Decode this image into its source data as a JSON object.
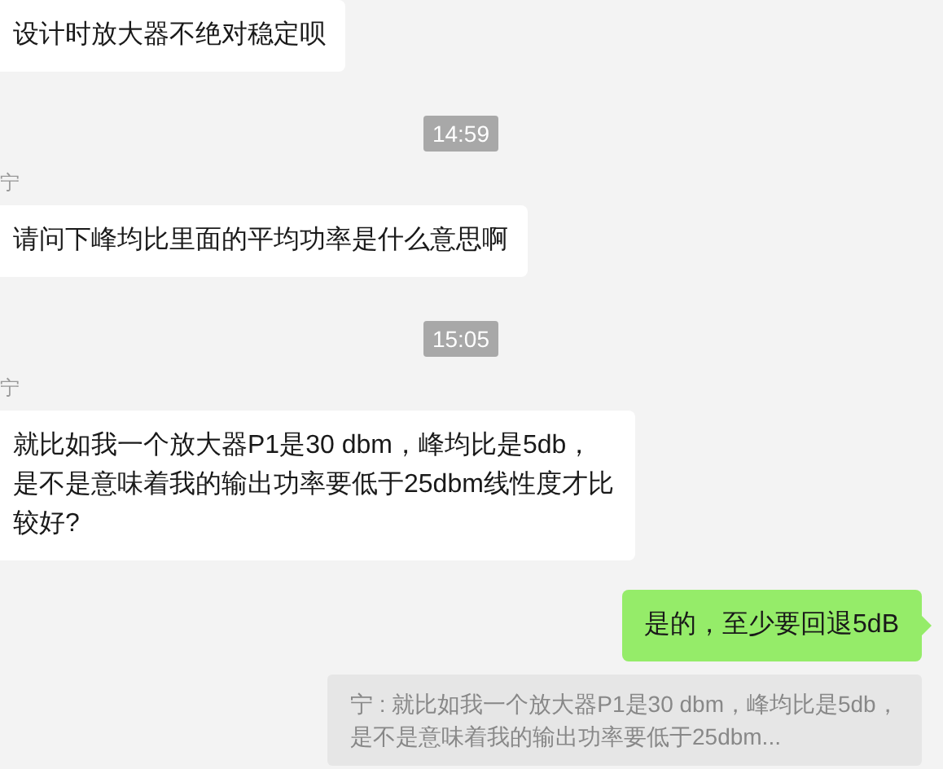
{
  "messages": [
    {
      "kind": "received",
      "text": "设计时放大器不绝对稳定呗"
    },
    {
      "kind": "time",
      "text": "14:59"
    },
    {
      "kind": "received",
      "sender": "宁",
      "text": "请问下峰均比里面的平均功率是什么意思啊"
    },
    {
      "kind": "time",
      "text": "15:05"
    },
    {
      "kind": "received",
      "sender": "宁",
      "text": "就比如我一个放大器P1是30 dbm，峰均比是5db，是不是意味着我的输出功率要低于25dbm线性度才比较好?"
    },
    {
      "kind": "sent",
      "text": "是的，至少要回退5dB"
    },
    {
      "kind": "quote",
      "text": "宁 : 就比如我一个放大器P1是30 dbm，峰均比是5db，是不是意味着我的输出功率要低于25dbm..."
    }
  ]
}
